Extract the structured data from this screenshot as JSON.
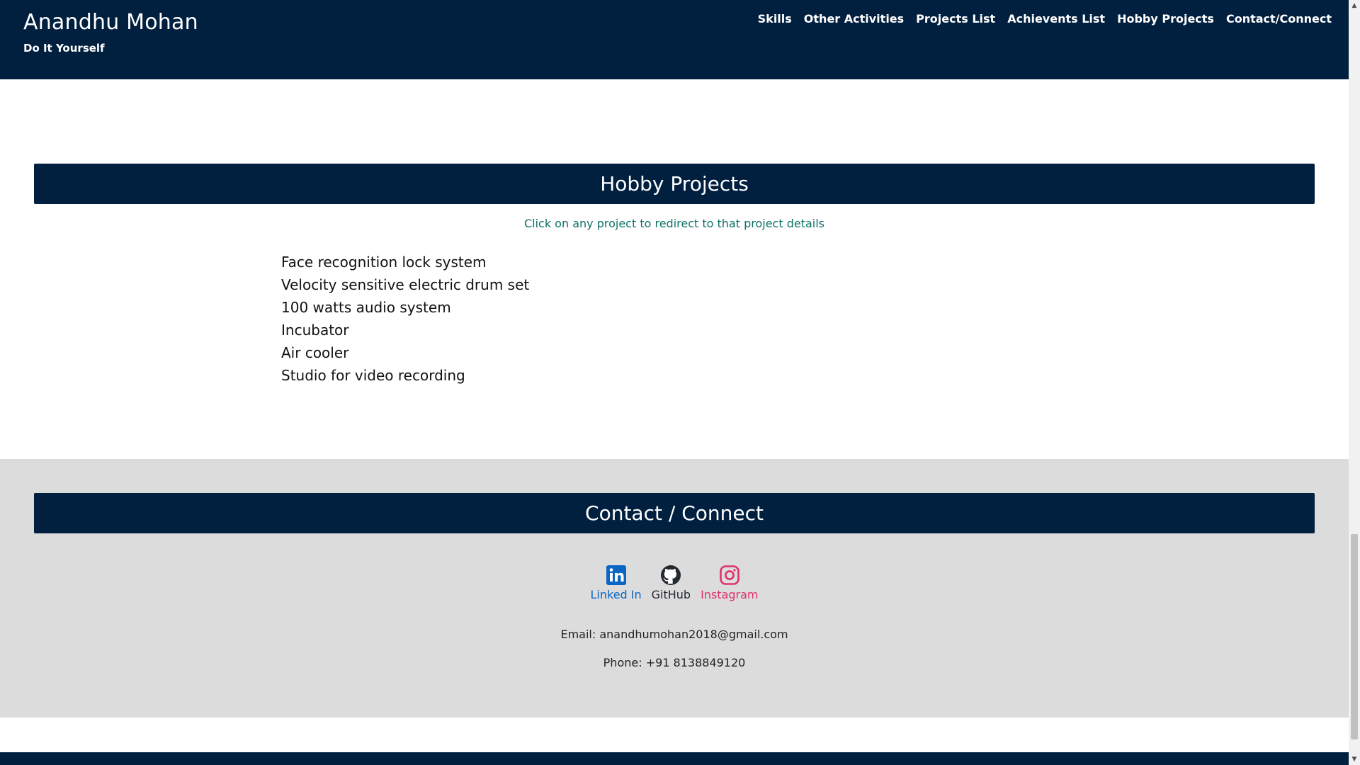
{
  "header": {
    "name": "Anandhu Mohan",
    "tagline": "Do It Yourself",
    "nav": [
      {
        "label": "Skills"
      },
      {
        "label": "Other Activities"
      },
      {
        "label": "Projects List"
      },
      {
        "label": "Achievents List"
      },
      {
        "label": "Hobby Projects"
      },
      {
        "label": "Contact/Connect"
      }
    ]
  },
  "hobby": {
    "title": "Hobby Projects",
    "hint": "Click on any project to redirect to that project details",
    "projects": [
      "Face recognition lock system",
      "Velocity sensitive electric drum set",
      "100 watts audio system",
      "Incubator",
      "Air cooler",
      "Studio for video recording"
    ]
  },
  "contact": {
    "title": "Contact / Connect",
    "socials": [
      {
        "label": "Linked In",
        "icon": "linkedin-icon",
        "color": "#0a66c2"
      },
      {
        "label": "GitHub",
        "icon": "github-icon",
        "color": "#24292f"
      },
      {
        "label": "Instagram",
        "icon": "instagram-icon",
        "color": "#e1306c"
      }
    ],
    "email": "Email: anandhumohan2018@gmail.com",
    "phone": "Phone: +91 8138849120"
  },
  "colors": {
    "navy": "#011f3f",
    "hint_teal": "#0e7167",
    "contact_bg": "#dcdcdc"
  }
}
